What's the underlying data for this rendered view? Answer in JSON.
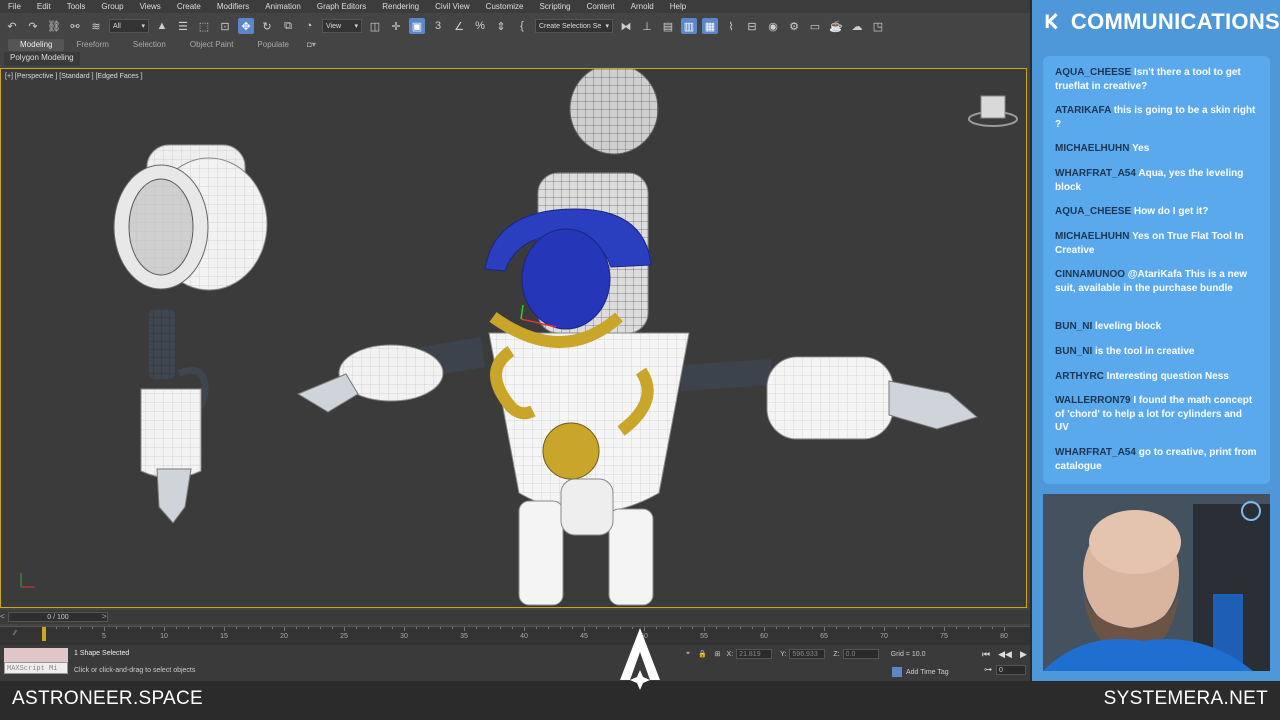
{
  "menu": [
    "File",
    "Edit",
    "Tools",
    "Group",
    "Views",
    "Create",
    "Modifiers",
    "Animation",
    "Graph Editors",
    "Rendering",
    "Civil View",
    "Customize",
    "Scripting",
    "Content",
    "Arnold",
    "Help"
  ],
  "toolbar": {
    "filter_value": "All",
    "ref_coord_value": "View",
    "selection_set_placeholder": "Create Selection Se"
  },
  "ribbon": {
    "tabs": [
      "Modeling",
      "Freeform",
      "Selection",
      "Object Paint",
      "Populate"
    ],
    "active_tab": "Modeling",
    "sub_tab": "Polygon Modeling"
  },
  "viewport": {
    "label": "[+] [Perspective ] [Standard ] [Edged Faces ]"
  },
  "timeline": {
    "slider_text": "0 / 100",
    "ruler_labels": [
      "5",
      "10",
      "15",
      "20",
      "25",
      "30",
      "35",
      "40",
      "45",
      "50",
      "55",
      "60",
      "65",
      "70",
      "75",
      "80"
    ]
  },
  "status": {
    "selection": "1 Shape Selected",
    "hint": "Click or click-and-drag to select objects",
    "maxscript_label": "MAXScript Mi",
    "x_label": "X:",
    "x_value": "21.819",
    "y_label": "Y:",
    "y_value": "596.933",
    "z_label": "Z:",
    "z_value": "0.0",
    "grid": "Grid = 10.0",
    "add_time_tag": "Add Time Tag",
    "frame_value": "0"
  },
  "overlay": {
    "left_site": "ASTRONEER.SPACE",
    "right_site": "SYSTEMERA.NET"
  },
  "chat": {
    "title": "COMMUNICATIONS",
    "messages": [
      {
        "user": "AQUA_CHEESE",
        "text": "Isn't there a tool to get trueflat in creative?"
      },
      {
        "user": "ATARIKAFA",
        "text": "this is going to be a skin right ?"
      },
      {
        "user": "MICHAELHUHN",
        "text": "Yes"
      },
      {
        "user": "WHARFRAT_A54",
        "text": "Aqua, yes the leveling block"
      },
      {
        "user": "AQUA_CHEESE",
        "text": "How do I get it?"
      },
      {
        "user": "MICHAELHUHN",
        "text": "Yes on True Flat Tool In Creative"
      },
      {
        "user": "CINNAMUNOO",
        "text": "@AtariKafa This is a new suit, available in the purchase bundle"
      },
      {
        "user": "BUN_NI",
        "text": "leveling block"
      },
      {
        "user": "BUN_NI",
        "text": "is the tool in creative"
      },
      {
        "user": "ARTHYRC",
        "text": "Interesting question Ness"
      },
      {
        "user": "WALLERRON79",
        "text": "I found the math concept of 'chord' to help a lot for cylinders and UV"
      },
      {
        "user": "WHARFRAT_A54",
        "text": "go to creative, print from catalogue"
      }
    ]
  },
  "colors": {
    "accent_blue": "#4e97d9",
    "chat_bg": "#5aa9ec",
    "viewport_border": "#c8a81e"
  }
}
